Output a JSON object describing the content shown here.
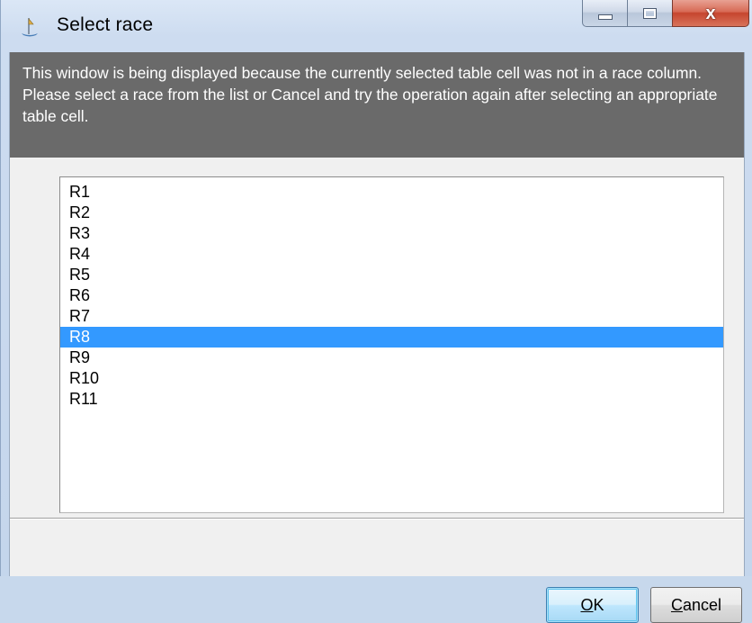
{
  "window": {
    "title": "Select race",
    "icon": "app-icon",
    "close_glyph": "x"
  },
  "message": {
    "text": "This window is being displayed because the currently selected table cell was not in a race column.  Please select a race from the list or Cancel and try the operation again after selecting an appropriate table cell."
  },
  "list": {
    "items": [
      "R1",
      "R2",
      "R3",
      "R4",
      "R5",
      "R6",
      "R7",
      "R8",
      "R9",
      "R10",
      "R11"
    ],
    "selected": "R8",
    "selection_color": "#3399ff"
  },
  "buttons": {
    "ok": {
      "mnemonic": "O",
      "rest": "K"
    },
    "cancel": {
      "mnemonic": "C",
      "rest": "ancel"
    }
  },
  "colors": {
    "message_panel_bg": "#6a6a6a",
    "message_text": "#ffffff",
    "close_button": "#c6452e"
  }
}
